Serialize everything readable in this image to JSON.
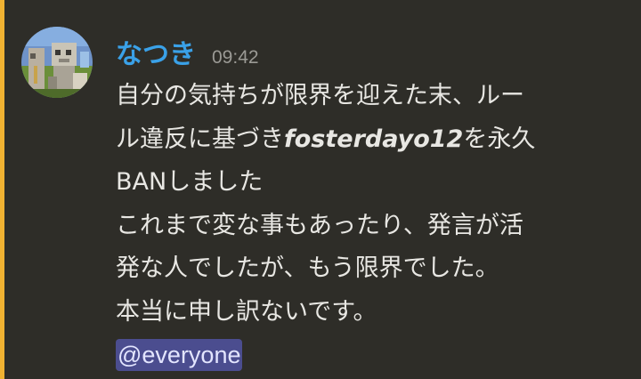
{
  "message": {
    "author": "なつき",
    "timestamp": "09:42",
    "lines": [
      "自分の気持ちが限界を迎えた末、ルー",
      "ル違反に基づき",
      "を永久",
      "BANしました",
      "これまで変な事もあったり、発言が活",
      "発な人でしたが、もう限界でした。",
      "本当に申し訳ないです。"
    ],
    "emphasized_username": "fosterdayo12",
    "mention": "@everyone"
  },
  "colors": {
    "accent_bar": "#f0b232",
    "author_name": "#3aa1e8",
    "background": "#2e2d28",
    "mention_background": "#4b4d8f"
  }
}
